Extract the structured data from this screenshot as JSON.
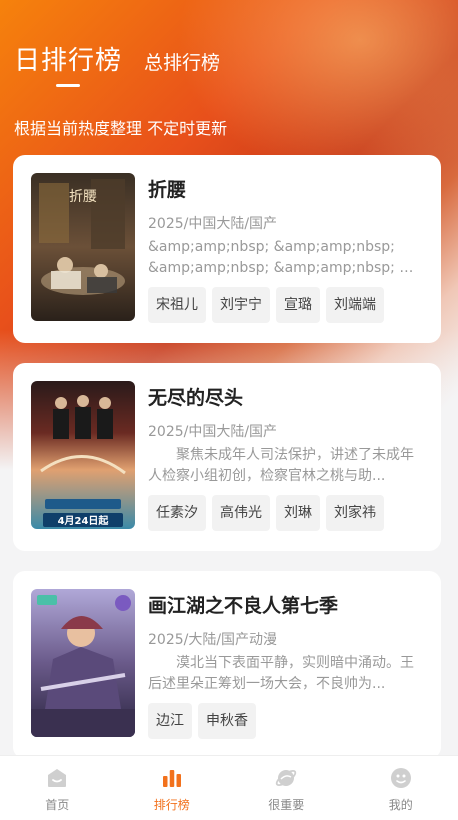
{
  "header": {
    "tabs": [
      {
        "label": "日排行榜",
        "active": true
      },
      {
        "label": "总排行榜",
        "active": false
      }
    ],
    "subtitle": "根据当前热度整理 不定时更新"
  },
  "colors": {
    "accent": "#f2711c",
    "inactive_icon": "#cfcfcf"
  },
  "cards": [
    {
      "title": "折腰",
      "meta": "2025/中国大陆/国产",
      "description": "&amp;amp;nbsp; &amp;amp;nbsp; &amp;amp;nbsp; &amp;amp;nbsp; 乱世 ...",
      "tags": [
        "宋祖儿",
        "刘宇宁",
        "宣璐",
        "刘端端"
      ],
      "poster_text": "折腰"
    },
    {
      "title": "无尽的尽头",
      "meta": "2025/中国大陆/国产",
      "description": "　　聚焦未成年人司法保护，讲述了未成年人检察小组初创，检察官林之桃与助...",
      "tags": [
        "任素汐",
        "高伟光",
        "刘琳",
        "刘家祎"
      ],
      "poster_text": "4月24日起"
    },
    {
      "title": "画江湖之不良人第七季",
      "meta": "2025/大陆/国产动漫",
      "description": "　　漠北当下表面平静，实则暗中涌动。王后述里朵正筹划一场大会，不良帅为...",
      "tags": [
        "边江",
        "申秋香"
      ],
      "poster_text": ""
    }
  ],
  "tabbar": [
    {
      "label": "首页",
      "icon": "home-icon",
      "active": false
    },
    {
      "label": "排行榜",
      "icon": "ranking-chart-icon",
      "active": true
    },
    {
      "label": "很重要",
      "icon": "planet-icon",
      "active": false
    },
    {
      "label": "我的",
      "icon": "profile-face-icon",
      "active": false
    }
  ]
}
